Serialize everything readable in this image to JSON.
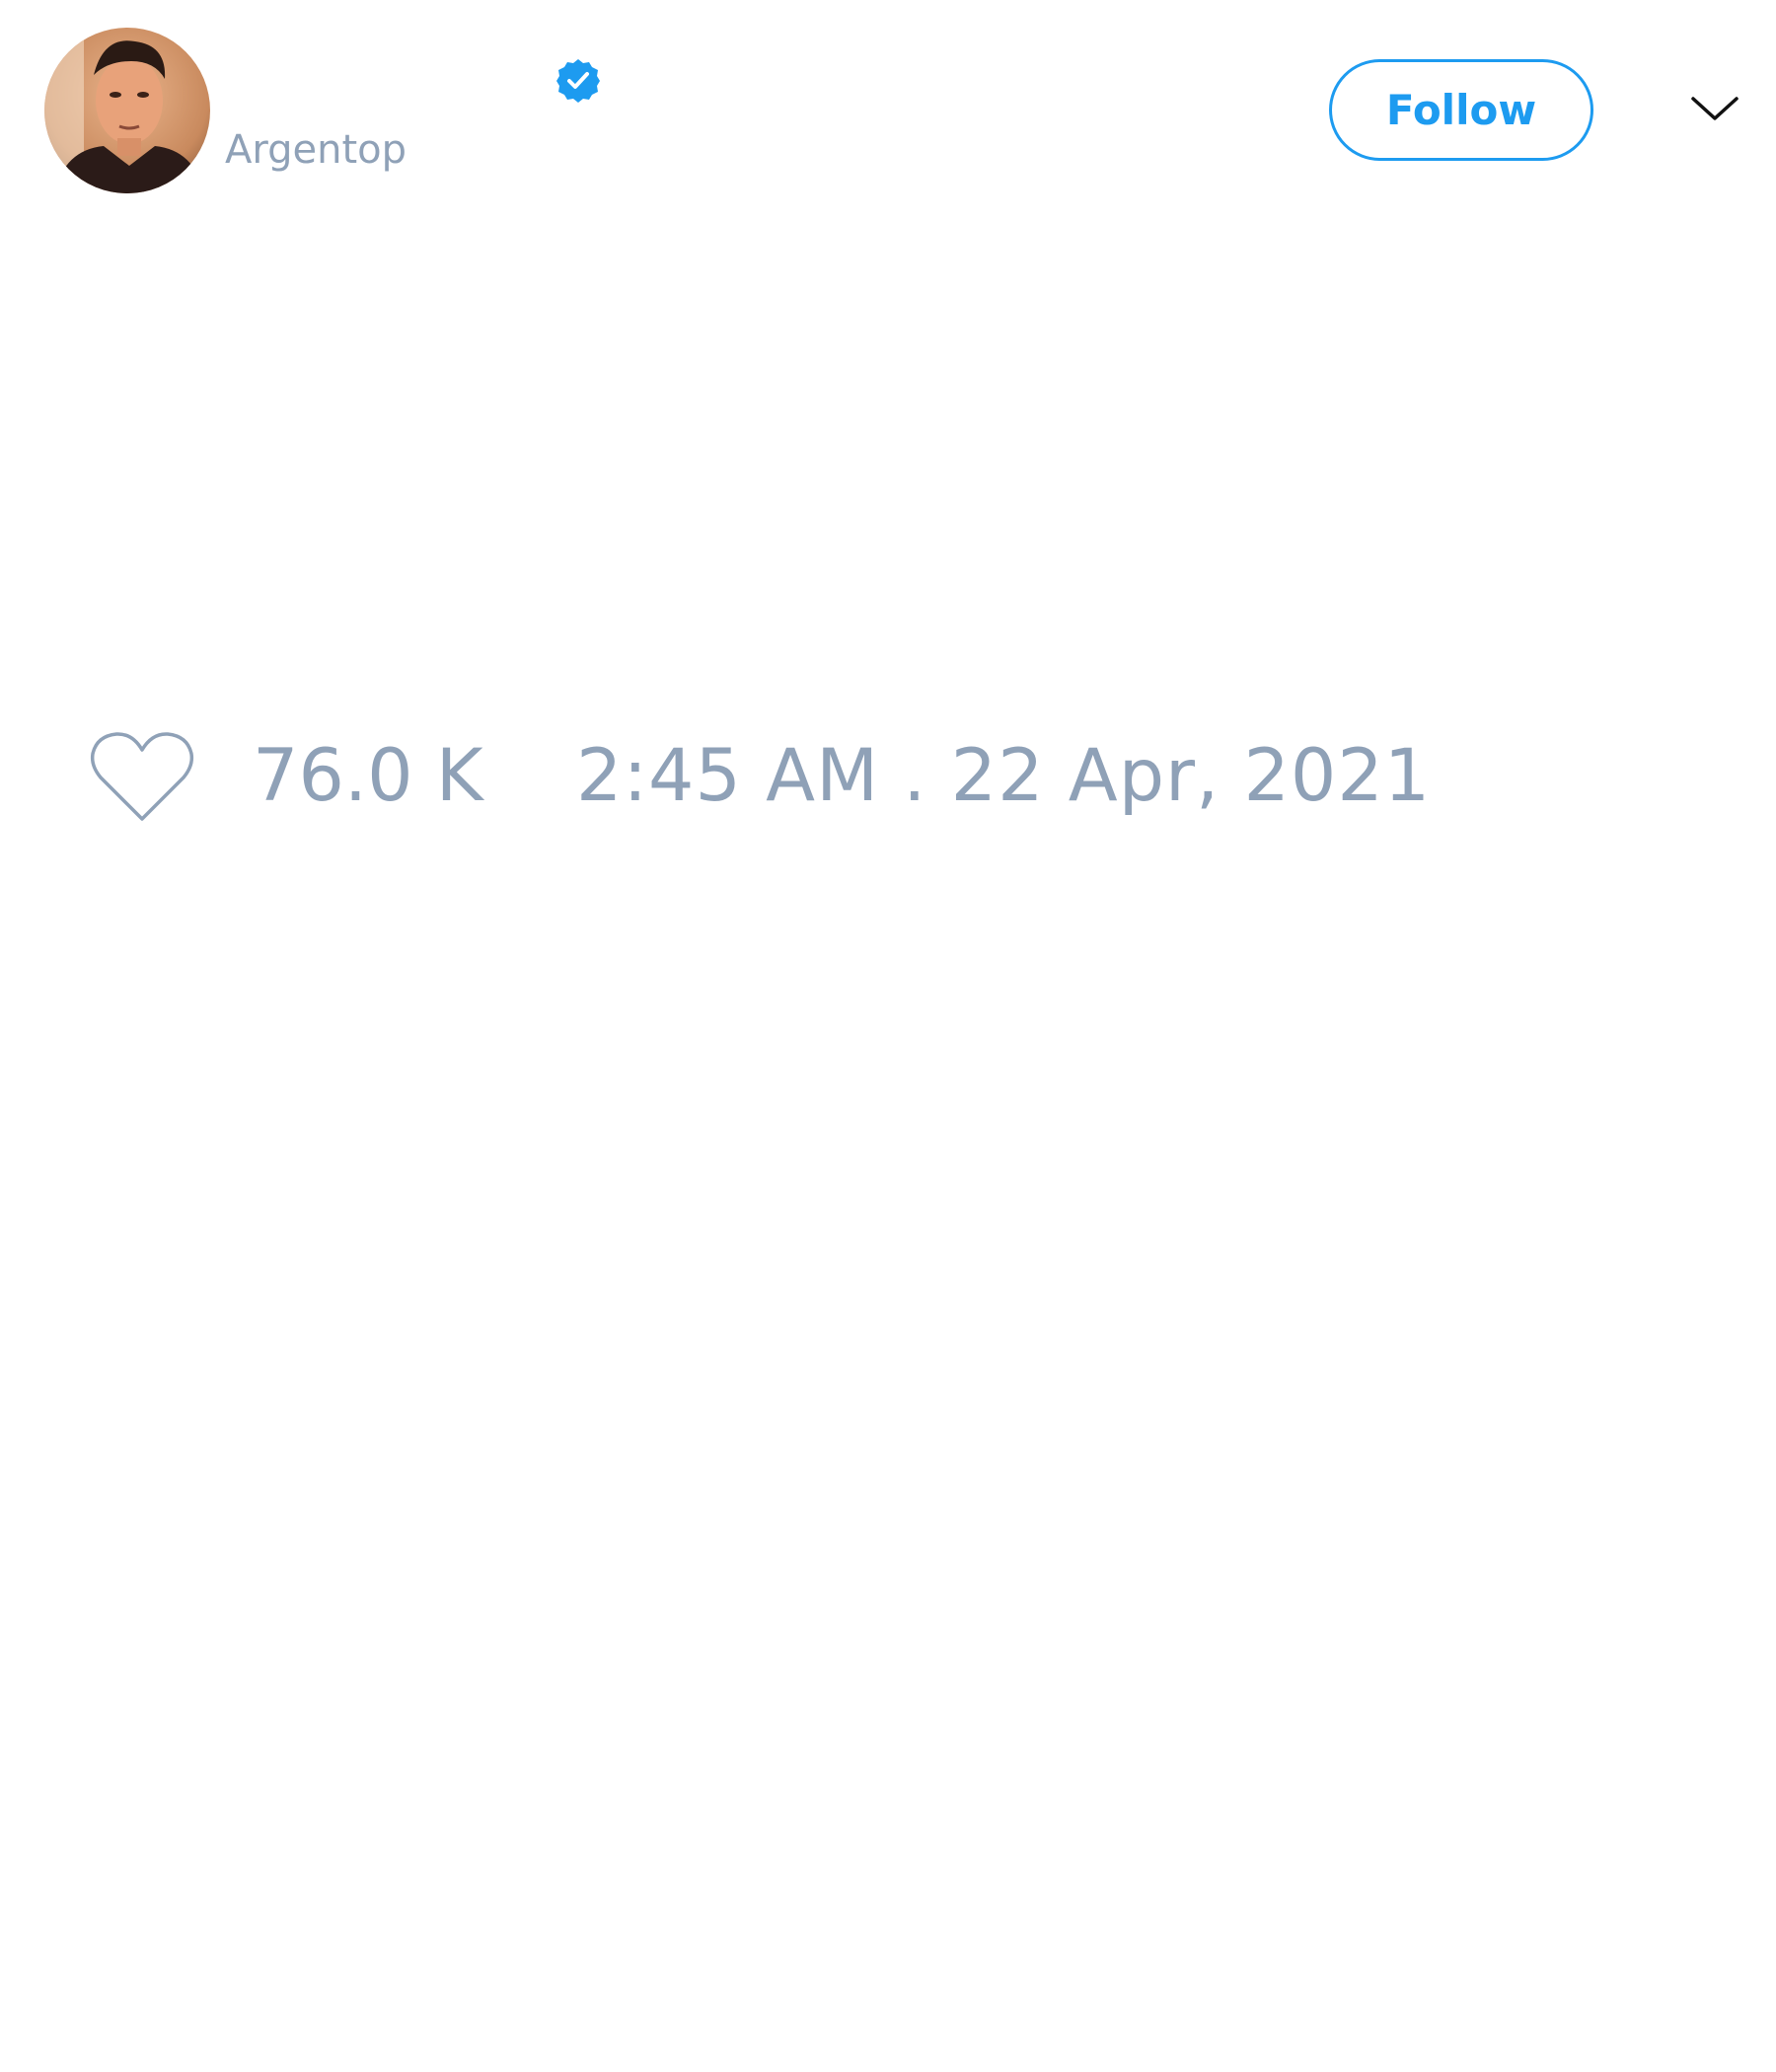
{
  "tweet": {
    "author": {
      "handle": "Argentop",
      "avatar_icon": "profile-photo",
      "verified_icon": "verified-badge-icon"
    },
    "follow_label": "Follow",
    "menu_icon": "chevron-down-icon",
    "like_icon": "heart-icon",
    "like_count": "76.0 K",
    "timestamp": "2:45 AM . 22 Apr, 2021"
  },
  "colors": {
    "accent": "#1d9bf0",
    "muted_text": "#8fa1b7",
    "background": "#ffffff"
  }
}
